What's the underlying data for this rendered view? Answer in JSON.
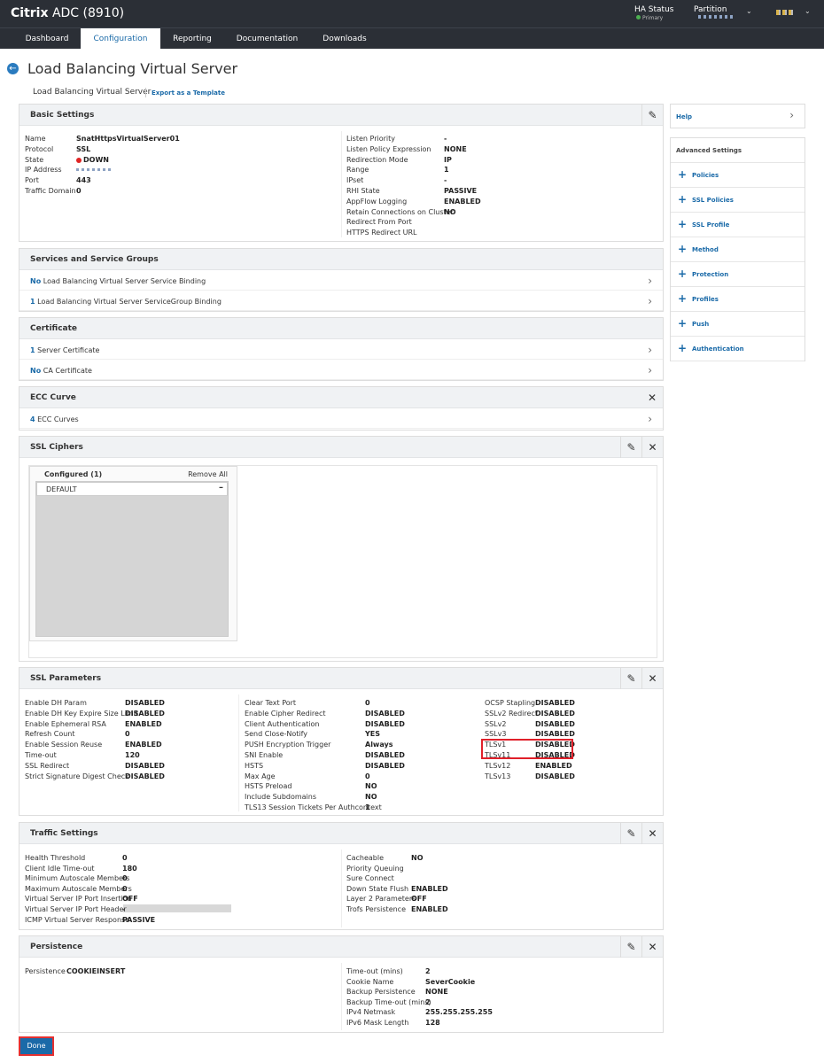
{
  "header": {
    "brand_bold": "Citrix",
    "brand_rest": "ADC (8910)",
    "ha_title": "HA Status",
    "ha_value": "Primary",
    "partition_label": "Partition"
  },
  "nav": {
    "tabs": [
      "Dashboard",
      "Configuration",
      "Reporting",
      "Documentation",
      "Downloads"
    ],
    "active": "Configuration"
  },
  "page": {
    "title": "Load Balancing Virtual Server",
    "breadcrumb": "Load Balancing Virtual Server",
    "export": "Export as a Template"
  },
  "basic": {
    "title": "Basic Settings",
    "left": [
      [
        "Name",
        "SnatHttpsVirtualServer01"
      ],
      [
        "Protocol",
        "SSL"
      ],
      [
        "State",
        "DOWN"
      ],
      [
        "IP Address",
        ""
      ],
      [
        "Port",
        "443"
      ],
      [
        "Traffic Domain",
        "0"
      ]
    ],
    "right": [
      [
        "Listen Priority",
        "-"
      ],
      [
        "Listen Policy Expression",
        "NONE"
      ],
      [
        "Redirection Mode",
        "IP"
      ],
      [
        "Range",
        "1"
      ],
      [
        "IPset",
        "-"
      ],
      [
        "RHI State",
        "PASSIVE"
      ],
      [
        "AppFlow Logging",
        "ENABLED"
      ],
      [
        "Retain Connections on Cluster",
        "NO"
      ],
      [
        "Redirect From Port",
        ""
      ],
      [
        "HTTPS Redirect URL",
        ""
      ]
    ]
  },
  "services": {
    "title": "Services and Service Groups",
    "rows": [
      {
        "n": "No",
        "t": "Load Balancing Virtual Server Service Binding"
      },
      {
        "n": "1",
        "t": "Load Balancing Virtual Server ServiceGroup Binding"
      }
    ]
  },
  "cert": {
    "title": "Certificate",
    "rows": [
      {
        "n": "1",
        "t": "Server Certificate"
      },
      {
        "n": "No",
        "t": "CA Certificate"
      }
    ]
  },
  "ecc": {
    "title": "ECC Curve",
    "rows": [
      {
        "n": "4",
        "t": "ECC Curves"
      }
    ]
  },
  "ciphers": {
    "title": "SSL Ciphers",
    "configured": "Configured (1)",
    "remove_all": "Remove All",
    "item": "DEFAULT"
  },
  "sslparams": {
    "title": "SSL Parameters",
    "c1": [
      [
        "Enable DH Param",
        "DISABLED"
      ],
      [
        "Enable DH Key Expire Size Limit",
        "DISABLED"
      ],
      [
        "Enable Ephemeral RSA",
        "ENABLED"
      ],
      [
        "Refresh Count",
        "0"
      ],
      [
        "Enable Session Reuse",
        "ENABLED"
      ],
      [
        "Time-out",
        "120"
      ],
      [
        "SSL Redirect",
        "DISABLED"
      ],
      [
        "Strict Signature Digest Check",
        "DISABLED"
      ]
    ],
    "c2": [
      [
        "Clear Text Port",
        "0"
      ],
      [
        "Enable Cipher Redirect",
        "DISABLED"
      ],
      [
        "Client Authentication",
        "DISABLED"
      ],
      [
        "Send Close-Notify",
        "YES"
      ],
      [
        "PUSH Encryption Trigger",
        "Always"
      ],
      [
        "SNI Enable",
        "DISABLED"
      ],
      [
        "HSTS",
        "DISABLED"
      ],
      [
        "Max Age",
        "0"
      ],
      [
        "HSTS Preload",
        "NO"
      ],
      [
        "Include Subdomains",
        "NO"
      ],
      [
        "TLS13 Session Tickets Per Authcontext",
        "1"
      ]
    ],
    "c3": [
      [
        "OCSP Stapling",
        "DISABLED"
      ],
      [
        "SSLv2 Redirect",
        "DISABLED"
      ],
      [
        "SSLv2",
        "DISABLED"
      ],
      [
        "SSLv3",
        "DISABLED"
      ],
      [
        "TLSv1",
        "DISABLED"
      ],
      [
        "TLSv11",
        "DISABLED"
      ],
      [
        "TLSv12",
        "ENABLED"
      ],
      [
        "TLSv13",
        "DISABLED"
      ]
    ]
  },
  "traffic": {
    "title": "Traffic Settings",
    "left": [
      [
        "Health Threshold",
        "0"
      ],
      [
        "Client Idle Time-out",
        "180"
      ],
      [
        "Minimum Autoscale Members",
        "0"
      ],
      [
        "Maximum Autoscale Members",
        "0"
      ],
      [
        "Virtual Server IP Port Insertion",
        "OFF"
      ],
      [
        "Virtual Server IP Port Header",
        "-"
      ],
      [
        "ICMP Virtual Server Response",
        "PASSIVE"
      ]
    ],
    "right": [
      [
        "Cacheable",
        "NO"
      ],
      [
        "Priority Queuing",
        ""
      ],
      [
        "Sure Connect",
        ""
      ],
      [
        "Down State Flush",
        "ENABLED"
      ],
      [
        "Layer 2 Parameters",
        "OFF"
      ],
      [
        "Trofs Persistence",
        "ENABLED"
      ]
    ]
  },
  "persistence": {
    "title": "Persistence",
    "left": [
      [
        "Persistence",
        "COOKIEINSERT"
      ]
    ],
    "right": [
      [
        "Time-out (mins)",
        "2"
      ],
      [
        "Cookie Name",
        "SeverCookie"
      ],
      [
        "Backup Persistence",
        "NONE"
      ],
      [
        "Backup Time-out (mins)",
        "2"
      ],
      [
        "IPv4 Netmask",
        "255.255.255.255"
      ],
      [
        "IPv6 Mask Length",
        "128"
      ]
    ]
  },
  "sidebar": {
    "help": "Help",
    "advanced": "Advanced Settings",
    "items": [
      "Policies",
      "SSL Policies",
      "SSL Profile",
      "Method",
      "Protection",
      "Profiles",
      "Push",
      "Authentication"
    ]
  },
  "done": "Done"
}
